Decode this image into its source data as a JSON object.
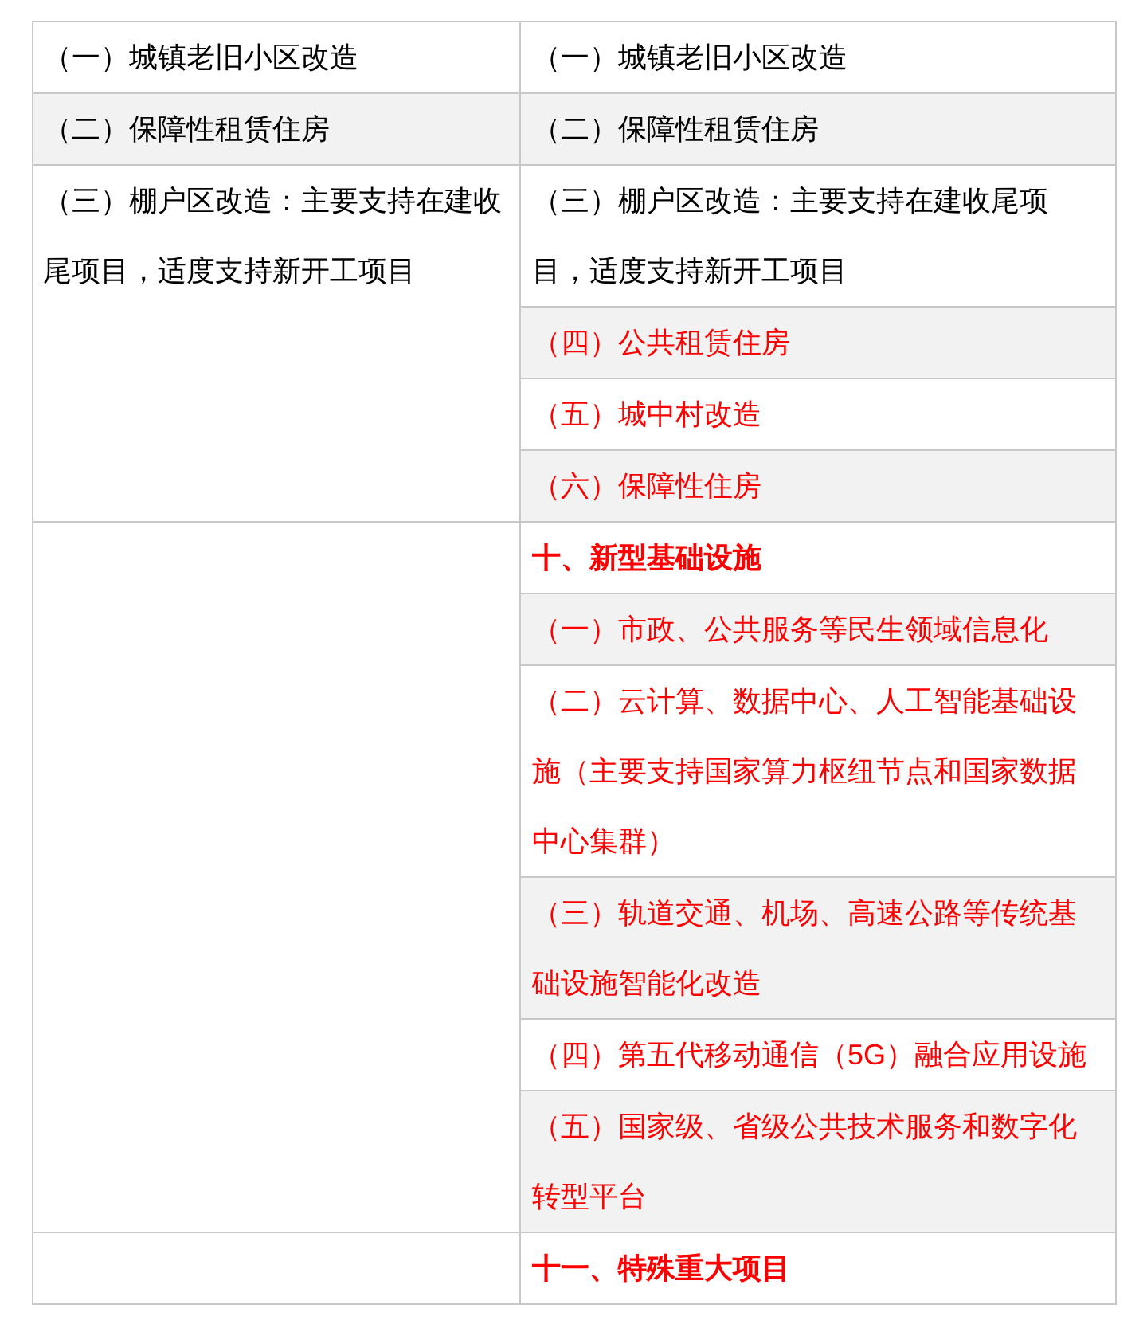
{
  "table": {
    "groups": [
      {
        "left": {
          "text": "（一）城镇老旧小区改造",
          "shaded": false
        },
        "right": [
          {
            "text": "（一）城镇老旧小区改造",
            "shaded": false,
            "kind": "item",
            "color": "#000000"
          }
        ]
      },
      {
        "left": {
          "text": "（二）保障性租赁住房",
          "shaded": true
        },
        "right": [
          {
            "text": "（二）保障性租赁住房",
            "shaded": true,
            "kind": "item",
            "color": "#000000"
          }
        ]
      },
      {
        "left": {
          "text": "（三）棚户区改造：主要支持在建收尾项目，适度支持新开工项目",
          "shaded": false
        },
        "right": [
          {
            "text": "（三）棚户区改造：主要支持在建收尾项目，适度支持新开工项目",
            "shaded": false,
            "kind": "item",
            "color": "#000000"
          },
          {
            "text": "（四）公共租赁住房",
            "shaded": true,
            "kind": "item",
            "color": "#ff0000"
          },
          {
            "text": "（五）城中村改造",
            "shaded": false,
            "kind": "item",
            "color": "#ff0000"
          },
          {
            "text": "（六）保障性住房",
            "shaded": true,
            "kind": "item",
            "color": "#ff0000"
          }
        ]
      },
      {
        "right": [
          {
            "text": "十、新型基础设施",
            "shaded": false,
            "kind": "heading",
            "color": "#ff0000"
          },
          {
            "text": "（一）市政、公共服务等民生领域信息化",
            "shaded": true,
            "kind": "item",
            "color": "#ff0000"
          },
          {
            "text": "（二）云计算、数据中心、人工智能基础设施（主要支持国家算力枢纽节点和国家数据中心集群）",
            "shaded": false,
            "kind": "item",
            "color": "#ff0000"
          },
          {
            "text": "（三）轨道交通、机场、高速公路等传统基础设施智能化改造",
            "shaded": true,
            "kind": "item",
            "color": "#ff0000"
          },
          {
            "text": "（四）第五代移动通信（5G）融合应用设施",
            "shaded": false,
            "kind": "item",
            "color": "#ff0000"
          },
          {
            "text": "（五）国家级、省级公共技术服务和数字化转型平台",
            "shaded": true,
            "kind": "item",
            "color": "#ff0000"
          }
        ]
      },
      {
        "right": [
          {
            "text": "十一、特殊重大项目",
            "shaded": false,
            "kind": "heading",
            "color": "#ff0000"
          }
        ]
      }
    ]
  }
}
